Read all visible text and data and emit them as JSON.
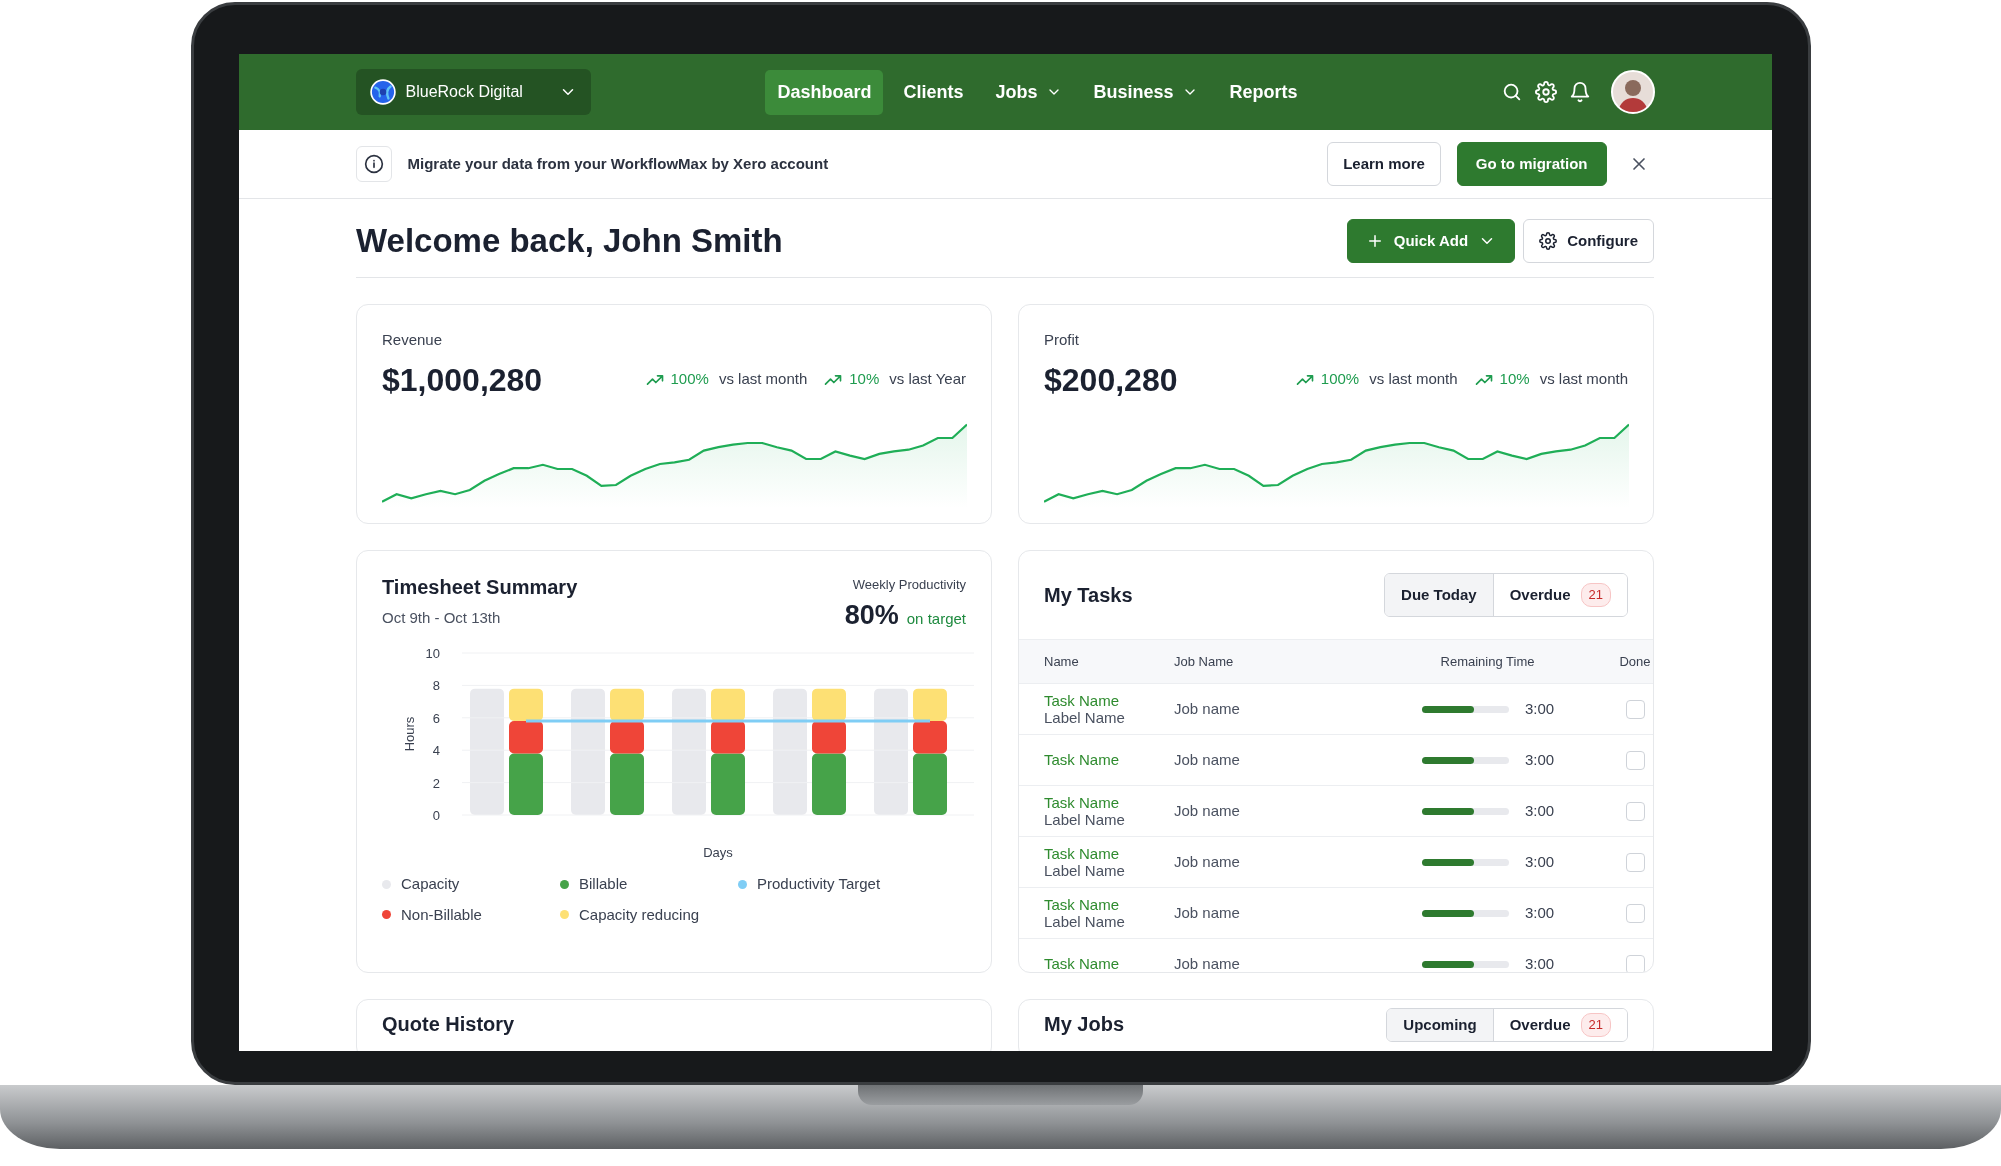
{
  "nav": {
    "org": "BlueRock Digital",
    "items": [
      {
        "label": "Dashboard",
        "selected": true,
        "dropdown": false
      },
      {
        "label": "Clients",
        "selected": false,
        "dropdown": false
      },
      {
        "label": "Jobs",
        "selected": false,
        "dropdown": true
      },
      {
        "label": "Business",
        "selected": false,
        "dropdown": true
      },
      {
        "label": "Reports",
        "selected": false,
        "dropdown": false
      }
    ]
  },
  "banner": {
    "message": "Migrate your data from your WorkflowMax by Xero account",
    "secondary_button": "Learn more",
    "primary_button": "Go to migration"
  },
  "welcome": "Welcome back, John Smith",
  "actions": {
    "quick_add": "Quick Add",
    "configure": "Configure"
  },
  "stats": [
    {
      "title": "Revenue",
      "value": "$1,000,280",
      "trends": [
        {
          "change": "100%",
          "label": "vs last month"
        },
        {
          "change": "10%",
          "label": "vs last Year"
        }
      ]
    },
    {
      "title": "Profit",
      "value": "$200,280",
      "trends": [
        {
          "change": "100%",
          "label": "vs last month"
        },
        {
          "change": "10%",
          "label": "vs last month"
        }
      ]
    }
  ],
  "timesheet": {
    "capacity": {
      "label": "Capacity",
      "color": "#e8e9ed"
    },
    "title": "Timesheet Summary",
    "range": "Oct 9th - Oct 13th",
    "productivity_label": "Weekly Productivity",
    "productivity": "80%",
    "status": "on target",
    "chart_data": {
      "type": "bar",
      "xlabel": "Days",
      "ylabel": "Hours",
      "stacked": true,
      "grid": true,
      "ylim": [
        0,
        10
      ],
      "yticks": [
        0,
        2,
        4,
        6,
        8,
        10
      ],
      "series": [
        {
          "name": "Billable",
          "color": "#46a349",
          "values": [
            3.8,
            3.8,
            3.8,
            3.8,
            3.8
          ]
        },
        {
          "name": "Productivity Target",
          "type": "line",
          "color": "#7fcdf5",
          "values": [
            5.8,
            5.8,
            5.8,
            5.8,
            5.8
          ]
        },
        {
          "name": "Non-Billable",
          "color": "#ef4538",
          "values": [
            2,
            2,
            2,
            2,
            2
          ]
        },
        {
          "name": "Capacity reducing",
          "color": "#fde074",
          "values": [
            2,
            2,
            2,
            2,
            2
          ]
        }
      ]
    }
  },
  "tasks": {
    "title": "My Tasks",
    "tabs": [
      {
        "label": "Due Today",
        "selected": true
      },
      {
        "label": "Overdue",
        "count": "21",
        "selected": false
      }
    ],
    "columns": [
      "Name",
      "Job Name",
      "Remaining Time",
      "Done"
    ],
    "rows": [
      {
        "task": "Task Name",
        "label": "Label Name",
        "job": "Job name",
        "level": 0.6,
        "time": "3:00",
        "done": false
      },
      {
        "task": "Task Name",
        "job": "Job name",
        "level": 0.6,
        "time": "3:00",
        "done": false
      },
      {
        "task": "Task Name",
        "label": "Label Name",
        "job": "Job name",
        "level": 0.6,
        "time": "3:00",
        "done": false
      },
      {
        "task": "Task Name",
        "label": "Label Name",
        "job": "Job name",
        "level": 0.6,
        "time": "3:00",
        "done": false
      },
      {
        "task": "Task Name",
        "label": "Label Name",
        "job": "Job name",
        "level": 0.6,
        "time": "3:00",
        "done": false
      },
      {
        "task": "Task Name",
        "job": "Job name",
        "level": 0.6,
        "time": "3:00",
        "done": false
      }
    ]
  },
  "lower": [
    {
      "title": "Quote History"
    },
    {
      "title": "My Jobs",
      "tabs": [
        {
          "label": "Upcoming",
          "selected": true
        },
        {
          "label": "Overdue",
          "count": "21",
          "selected": false
        }
      ]
    }
  ]
}
